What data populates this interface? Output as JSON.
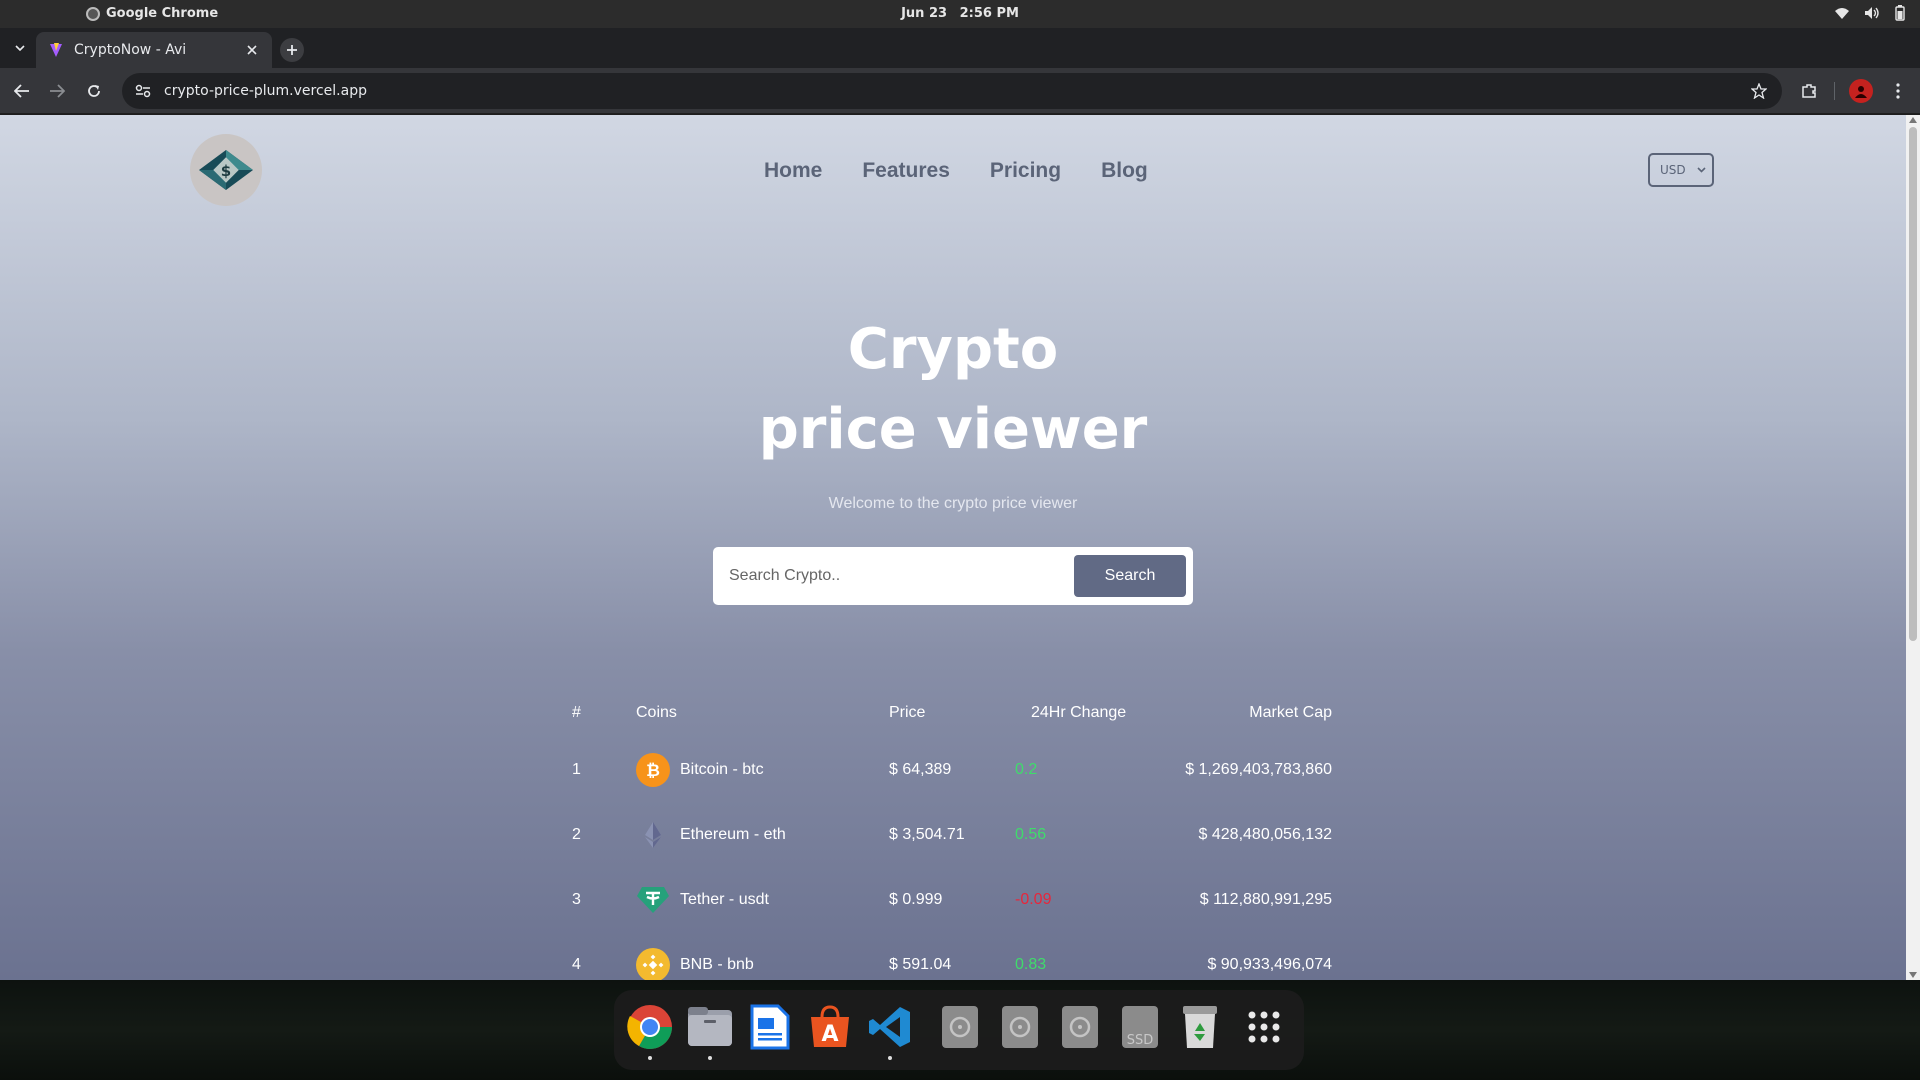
{
  "os": {
    "app_name": "Google Chrome",
    "date": "Jun 23",
    "time": "2:56 PM"
  },
  "browser": {
    "tab_title": "CryptoNow - Avi",
    "url": "crypto-price-plum.vercel.app"
  },
  "nav": {
    "items": [
      "Home",
      "Features",
      "Pricing",
      "Blog"
    ],
    "currency": "USD"
  },
  "hero": {
    "title_line1": "Crypto",
    "title_line2": "price viewer",
    "subtitle": "Welcome to the crypto price viewer",
    "search_placeholder": "Search Crypto..",
    "search_button": "Search"
  },
  "table": {
    "headers": [
      "#",
      "Coins",
      "Price",
      "24Hr Change",
      "Market Cap"
    ],
    "rows": [
      {
        "rank": "1",
        "coin": "Bitcoin - btc",
        "icon": "bitcoin-icon",
        "icon_color": "#f7931a",
        "price": "$ 64,389",
        "change": "0.2",
        "trend": "pos",
        "cap": "$ 1,269,403,783,860"
      },
      {
        "rank": "2",
        "coin": "Ethereum - eth",
        "icon": "ethereum-icon",
        "icon_color": "#627eea",
        "price": "$ 3,504.71",
        "change": "0.56",
        "trend": "pos",
        "cap": "$ 428,480,056,132"
      },
      {
        "rank": "3",
        "coin": "Tether - usdt",
        "icon": "tether-icon",
        "icon_color": "#26a17b",
        "price": "$ 0.999",
        "change": "-0.09",
        "trend": "neg",
        "cap": "$ 112,880,991,295"
      },
      {
        "rank": "4",
        "coin": "BNB - bnb",
        "icon": "bnb-icon",
        "icon_color": "#f3ba2f",
        "price": "$ 591.04",
        "change": "0.83",
        "trend": "pos",
        "cap": "$ 90,933,496,074"
      }
    ]
  },
  "colors": {
    "positive": "#3fdc6b",
    "negative": "#e8263b",
    "nav_text": "#5b6478",
    "button": "#616a85"
  },
  "dock": {
    "ssd_label": "SSD",
    "items": [
      "chrome-icon",
      "files-icon",
      "text-editor-icon",
      "app-center-icon",
      "vscode-icon",
      "disk-icon",
      "disk-icon",
      "disk-icon",
      "ssd-drive-icon",
      "trash-icon",
      "app-grid-icon"
    ]
  }
}
